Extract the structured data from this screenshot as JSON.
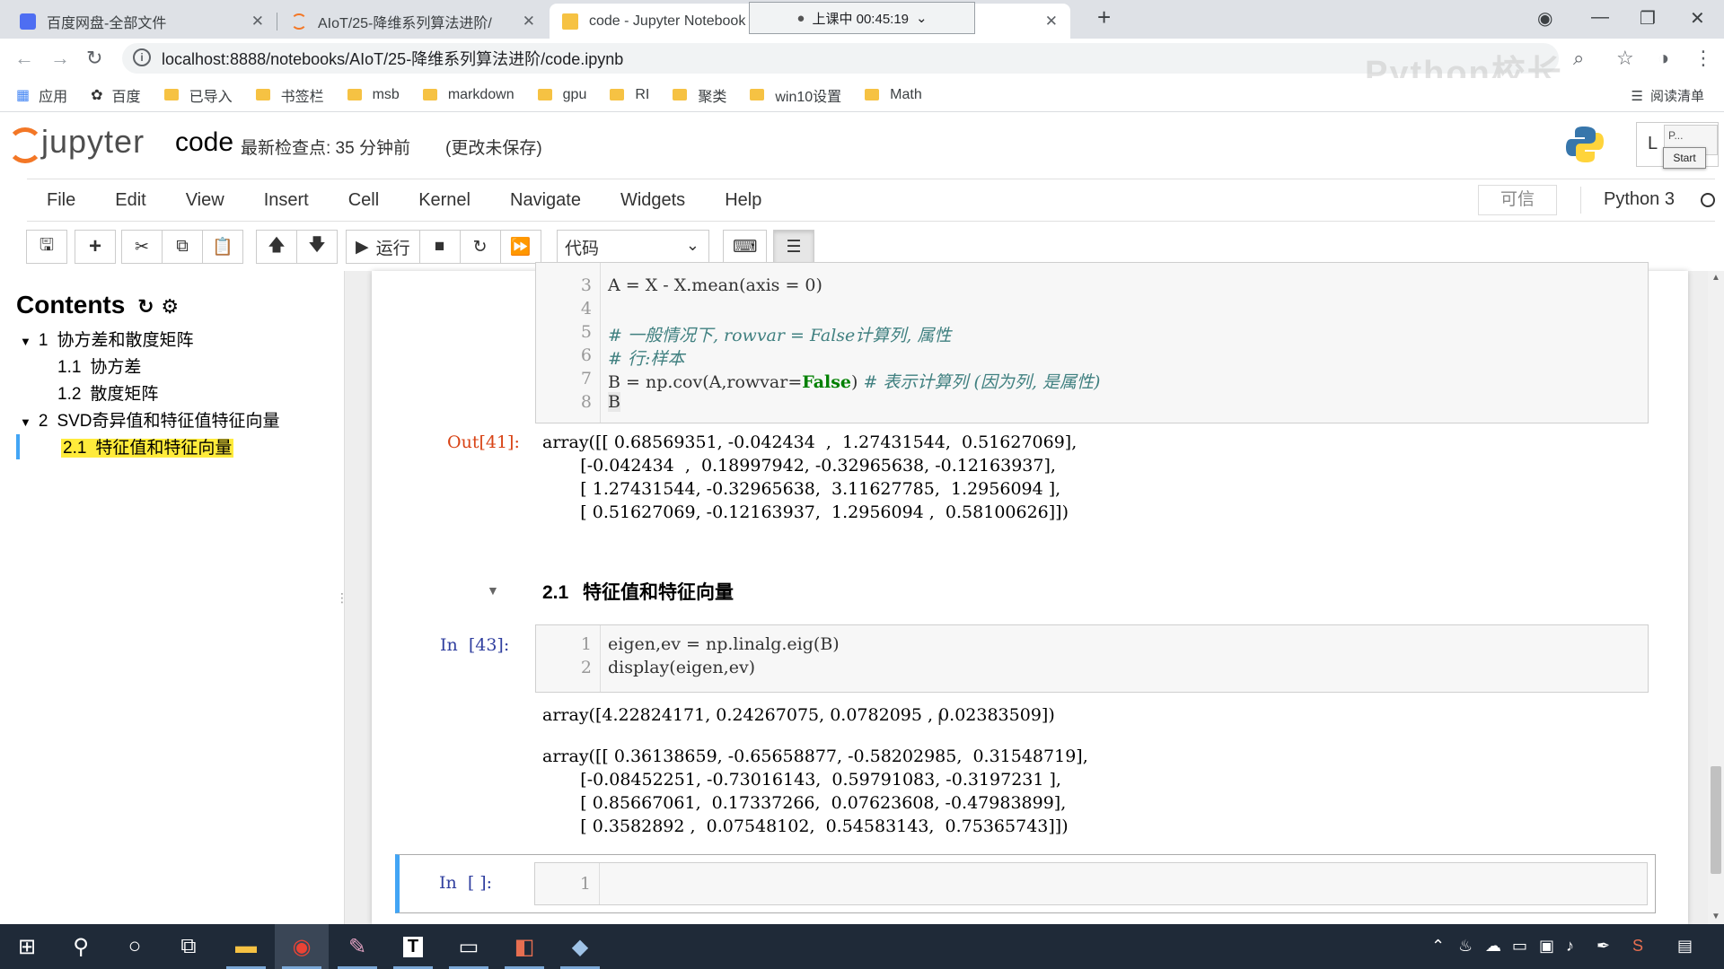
{
  "browser": {
    "tabs": [
      {
        "title": "百度网盘-全部文件",
        "favicon_color": "#4e6ef2"
      },
      {
        "title": "AIoT/25-降维系列算法进阶/",
        "favicon_color": "#f37726"
      },
      {
        "title": "code - Jupyter Notebook",
        "favicon_color": "#f37726"
      }
    ],
    "recording_timer": "上课中 00:45:19",
    "url": "localhost:8888/notebooks/AIoT/25-降维系列算法进阶/code.ipynb",
    "watermark": "Python校长",
    "bookmarks": [
      "应用",
      "百度",
      "已导入",
      "书签栏",
      "msb",
      "markdown",
      "gpu",
      "RI",
      "聚类",
      "win10设置",
      "Math"
    ],
    "reading_list": "阅读清单"
  },
  "jupyter": {
    "logo_text": "jupyter",
    "notebook_name": "code",
    "checkpoint": "最新检查点: 35 分钟前",
    "unsaved": "(更改未保存)",
    "login_label": "L",
    "start_popup": "Start",
    "popup_label": "P...",
    "menu": [
      "File",
      "Edit",
      "View",
      "Insert",
      "Cell",
      "Kernel",
      "Navigate",
      "Widgets",
      "Help"
    ],
    "trusted": "可信",
    "kernel": "Python 3",
    "toolbar": {
      "run_label": "运行",
      "cell_type": "代码"
    }
  },
  "toc": {
    "title": "Contents",
    "items": [
      {
        "num": "1",
        "label": "协方差和散度矩阵"
      },
      {
        "num": "1.1",
        "label": "协方差"
      },
      {
        "num": "1.2",
        "label": "散度矩阵"
      },
      {
        "num": "2",
        "label": "SVD奇异值和特征值特征向量"
      },
      {
        "num": "2.1",
        "label": "特征值和特征向量"
      }
    ]
  },
  "cells": {
    "cell41": {
      "lines": [
        {
          "n": "3",
          "code": "A = X - X.mean(axis = 0)"
        },
        {
          "n": "4",
          "code": ""
        },
        {
          "n": "5",
          "code": "# 一般情况下, rowvar = False计算列, 属性"
        },
        {
          "n": "6",
          "code": "# 行:样本"
        },
        {
          "n": "7",
          "code_a": "B = np.cov(A,rowvar=",
          "kw": "False",
          "code_b": ") ",
          "comment": "# 表示计算列 (因为列, 是属性)"
        },
        {
          "n": "8",
          "code": "B"
        }
      ],
      "out_prompt": "Out[41]:",
      "output": [
        "array([[ 0.68569351, -0.042434  ,  1.27431544,  0.51627069],",
        "       [-0.042434  ,  0.18997942, -0.32965638, -0.12163937],",
        "       [ 1.27431544, -0.32965638,  3.11627785,  1.2956094 ],",
        "       [ 0.51627069, -0.12163937,  1.2956094 ,  0.58100626]])"
      ]
    },
    "heading": {
      "num": "2.1",
      "text": "特征值和特征向量"
    },
    "cell43": {
      "in_prompt": "In  [43]:",
      "lines": [
        {
          "n": "1",
          "code": "eigen,ev = np.linalg.eig(B)"
        },
        {
          "n": "2",
          "code": "display(eigen,ev)"
        }
      ],
      "output1": "array([4.22824171, 0.24267075, 0.0782095 , 0.02383509])",
      "output2": [
        "array([[ 0.36138659, -0.65658877, -0.58202985,  0.31548719],",
        "       [-0.08452251, -0.73016143,  0.59791083, -0.3197231 ],",
        "       [ 0.85667061,  0.17337266,  0.07623608, -0.47983899],",
        "       [ 0.3582892 ,  0.07548102,  0.54583143,  0.75365743]])"
      ]
    },
    "cell_empty": {
      "in_prompt": "In  [ ]:",
      "line": "1"
    }
  },
  "taskbar": {
    "apps": [
      "start-icon",
      "search-icon",
      "cortana-icon",
      "task-view-icon",
      "explorer-icon",
      "chrome-icon",
      "paint-icon",
      "typora-icon",
      "terminal-icon",
      "pdf-icon",
      "vs-icon"
    ]
  }
}
